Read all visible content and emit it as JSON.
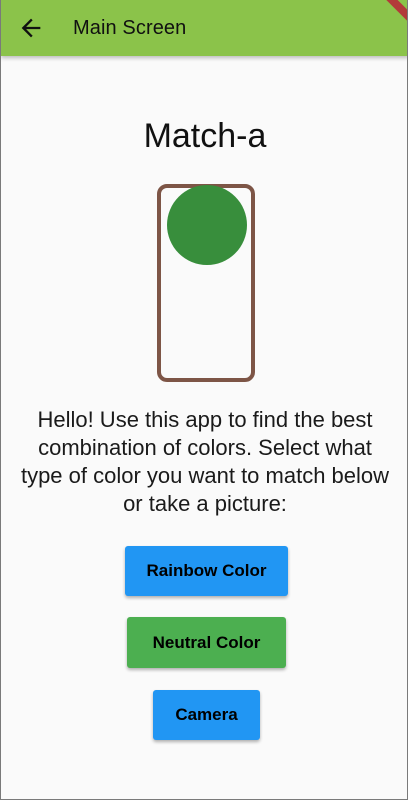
{
  "appbar": {
    "title": "Main Screen",
    "back_icon": "arrow-back-icon",
    "color": "#8bc34a"
  },
  "main": {
    "heading": "Match-a",
    "description": "Hello! Use this app to find the best combination of colors. Select what type of color you want to match below or take a picture:",
    "illustration": {
      "outline_color": "#7d5546",
      "circle_color": "#388e3c"
    }
  },
  "buttons": {
    "rainbow": {
      "label": "Rainbow Color",
      "color": "#2196f3"
    },
    "neutral": {
      "label": "Neutral Color",
      "color": "#4caf50"
    },
    "camera": {
      "label": "Camera",
      "color": "#2196f3"
    }
  }
}
